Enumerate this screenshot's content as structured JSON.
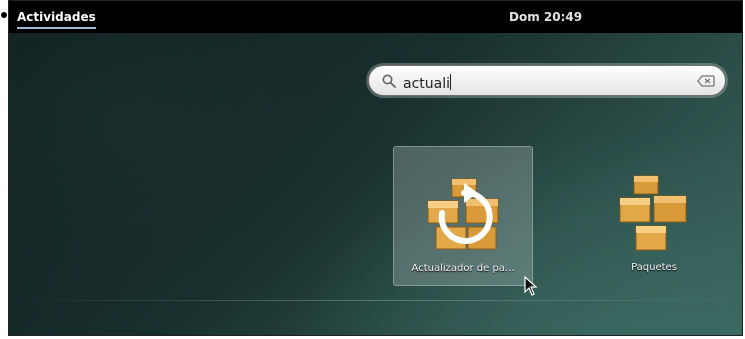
{
  "topbar": {
    "activities_label": "Actividades",
    "clock": "Dom 20:49"
  },
  "search": {
    "query": "actuali",
    "icon": "search-icon",
    "clear_icon": "clear-icon"
  },
  "results": [
    {
      "label": "Actualizador de pa...",
      "icon": "software-update-icon",
      "selected": true
    },
    {
      "label": "Paquetes",
      "icon": "packages-icon",
      "selected": false
    }
  ],
  "colors": {
    "topbar": "#000000",
    "selection_tile": "#a0afaf",
    "accent_underline": "#9bb7d4"
  }
}
